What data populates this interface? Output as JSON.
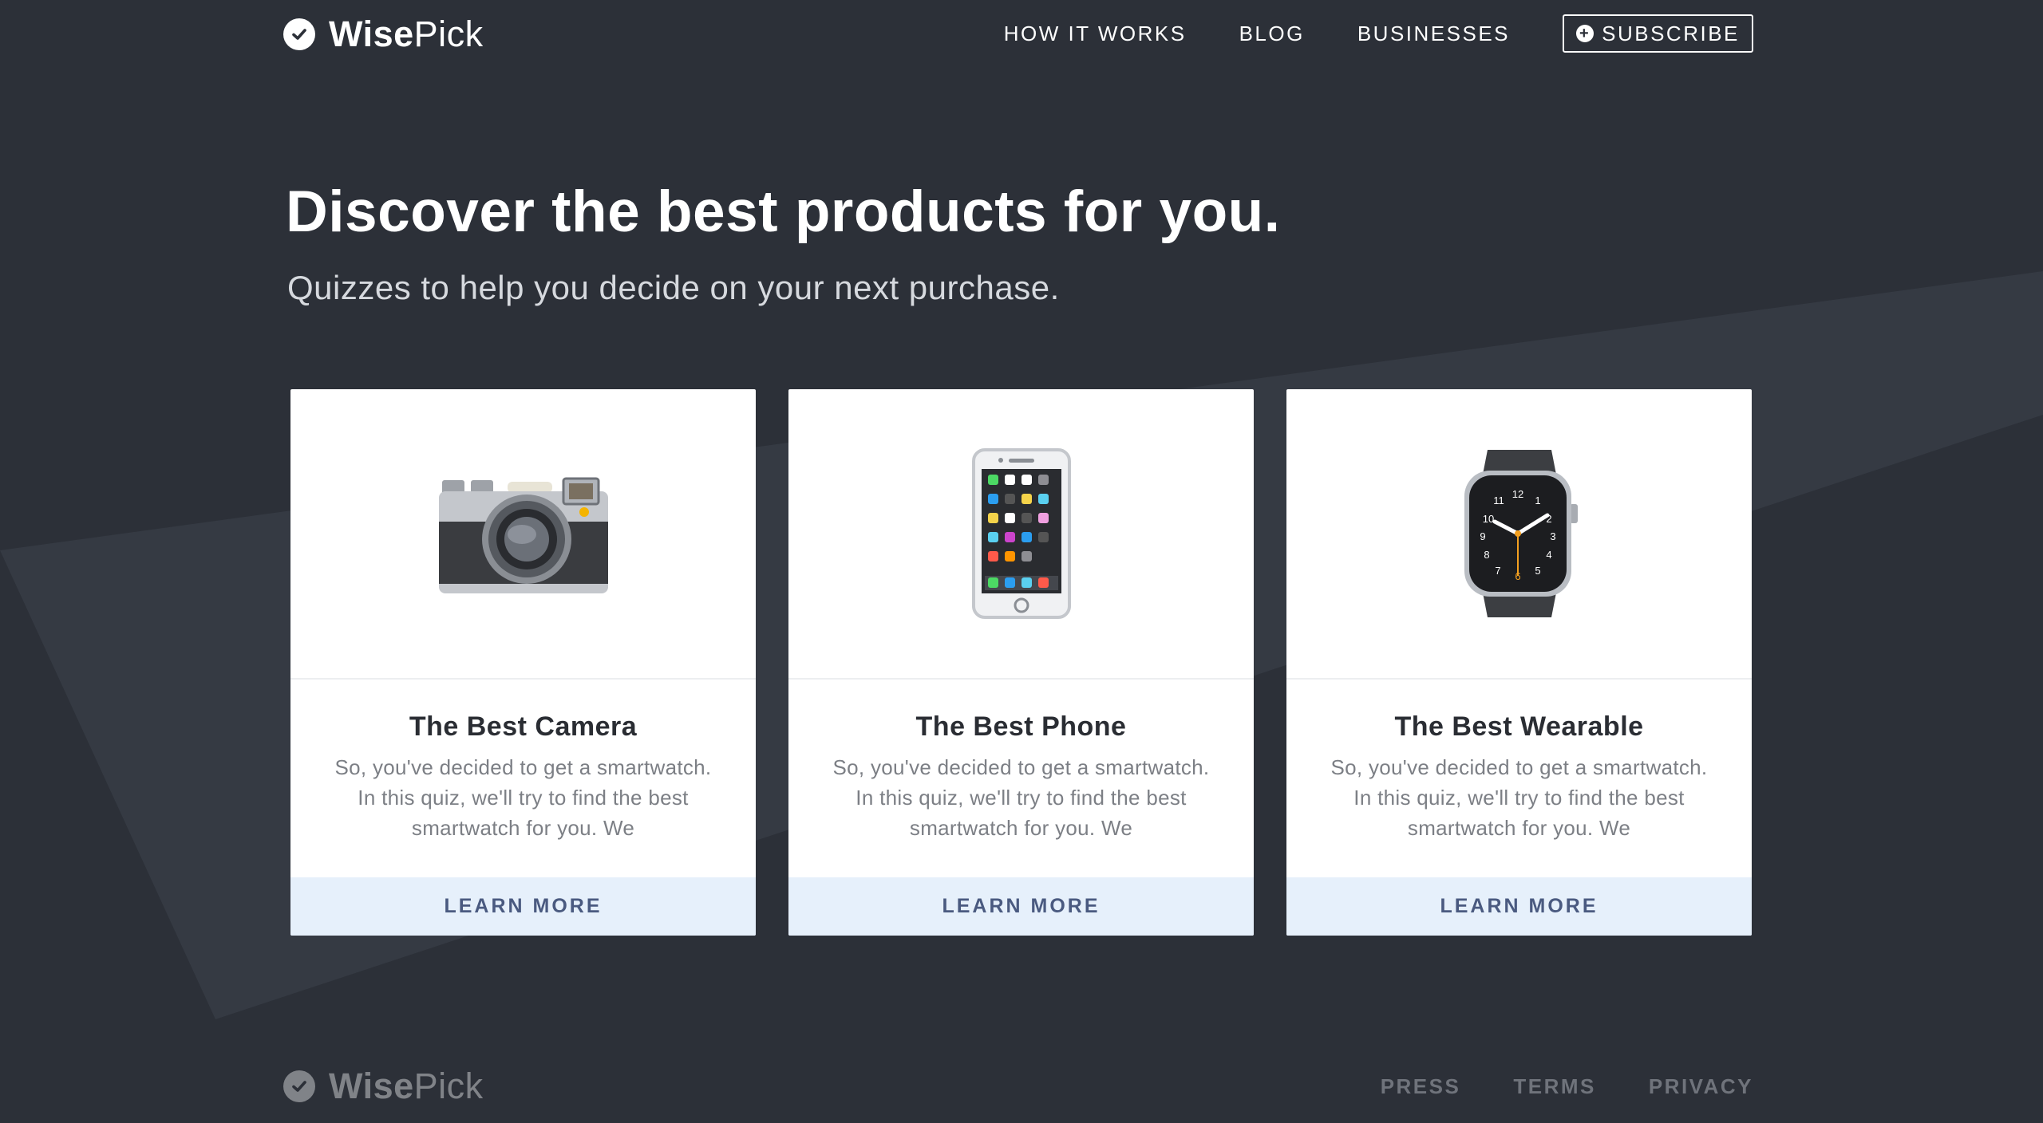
{
  "brand": {
    "name_bold": "Wise",
    "name_light": "Pick"
  },
  "nav": {
    "how_it_works": "HOW IT WORKS",
    "blog": "BLOG",
    "businesses": "BUSINESSES",
    "subscribe": "SUBSCRIBE"
  },
  "hero": {
    "title": "Discover the best products for you.",
    "subtitle": "Quizzes to help you decide on your next purchase."
  },
  "cards": [
    {
      "title": "The Best Camera",
      "description": "So, you've decided to get a smartwatch. In this quiz, we'll try to find the best smartwatch for you. We",
      "cta": "LEARN MORE",
      "icon": "camera-icon"
    },
    {
      "title": "The Best Phone",
      "description": "So, you've decided to get a smartwatch. In this quiz, we'll try to find the best smartwatch for you. We",
      "cta": "LEARN MORE",
      "icon": "phone-icon"
    },
    {
      "title": "The Best Wearable",
      "description": "So, you've decided to get a smartwatch. In this quiz, we'll try to find the best smartwatch for you. We",
      "cta": "LEARN MORE",
      "icon": "smartwatch-icon"
    }
  ],
  "footer": {
    "press": "PRESS",
    "terms": "TERMS",
    "privacy": "PRIVACY"
  },
  "colors": {
    "background": "#2c3038",
    "card_cta_bg": "#e6f0fb",
    "card_cta_text": "#4a5a80"
  }
}
